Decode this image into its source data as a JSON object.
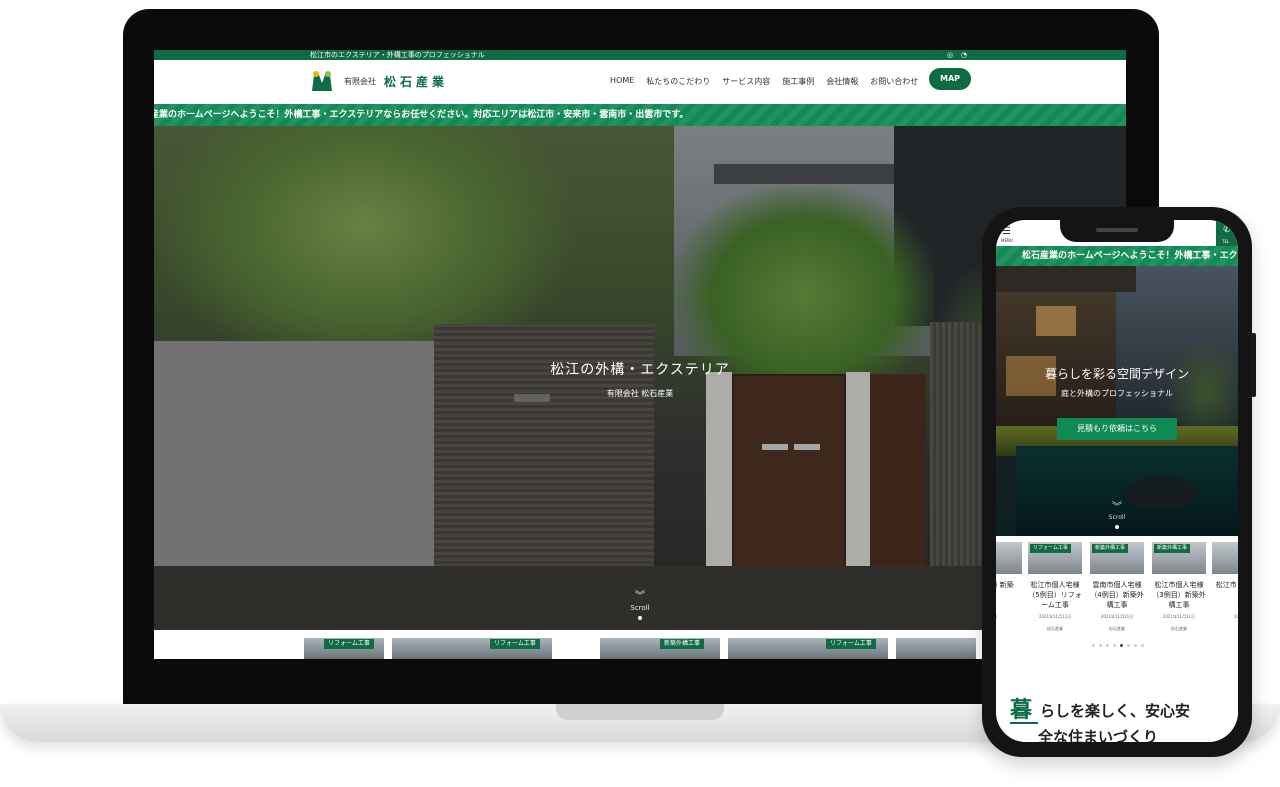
{
  "desktop": {
    "topbar": {
      "tagline": "松江市のエクステリア・外構工事のプロフェッショナル",
      "icons": [
        "instagram-icon",
        "rss-icon"
      ]
    },
    "header": {
      "logo_corp": "有限会社",
      "logo_name": "松石産業",
      "nav": [
        "HOME",
        "私たちのこだわり",
        "サービス内容",
        "施工事例",
        "会社情報",
        "お問い合わせ"
      ],
      "map_button": "MAP"
    },
    "marquee": "産業のホームページへようこそ！外構工事・エクステリアならお任せください。対応エリアは松江市・安来市・雲南市・出雲市です。",
    "hero": {
      "title": "松江の外構・エクステリア",
      "subtitle": "有限会社 松石産業",
      "scroll": "Scroll"
    },
    "card_badges": [
      "リフォーム工事",
      "リフォーム工事",
      "新築外構工事",
      "リフォーム工事"
    ]
  },
  "mobile": {
    "menu_label": "MENU",
    "tel_label": "TEL",
    "marquee": "松石産業のホームページへようこそ！外構工事・エク",
    "hero": {
      "title": "暮らしを彩る空間デザイン",
      "subtitle": "庭と外構のプロフェッショナル",
      "cta": "見積もり依頼はこちら",
      "scroll": "Scroll"
    },
    "works": [
      {
        "badge": "",
        "title": "人宅様 新築",
        "date": "日",
        "author": ""
      },
      {
        "badge": "リフォーム工事",
        "title": "松江市個人宅様（5例目）リフォーム工事",
        "date": "2021年11月11日",
        "author": "松石産業"
      },
      {
        "badge": "新築外構工事",
        "title": "雲南市個人宅様（4例目）新築外構工事",
        "date": "2021年11月11日",
        "author": "松石産業"
      },
      {
        "badge": "新築外構工事",
        "title": "松江市個人宅様（3例目）新築外構工事",
        "date": "2021年11月11日",
        "author": "松石産業"
      },
      {
        "badge": "",
        "title": "松江市（2例目",
        "date": "2021",
        "author": ""
      }
    ],
    "heading_first": "暮",
    "heading_rest": "らしを楽しく、安心安",
    "heading_line2": "全な住まいづくり"
  }
}
